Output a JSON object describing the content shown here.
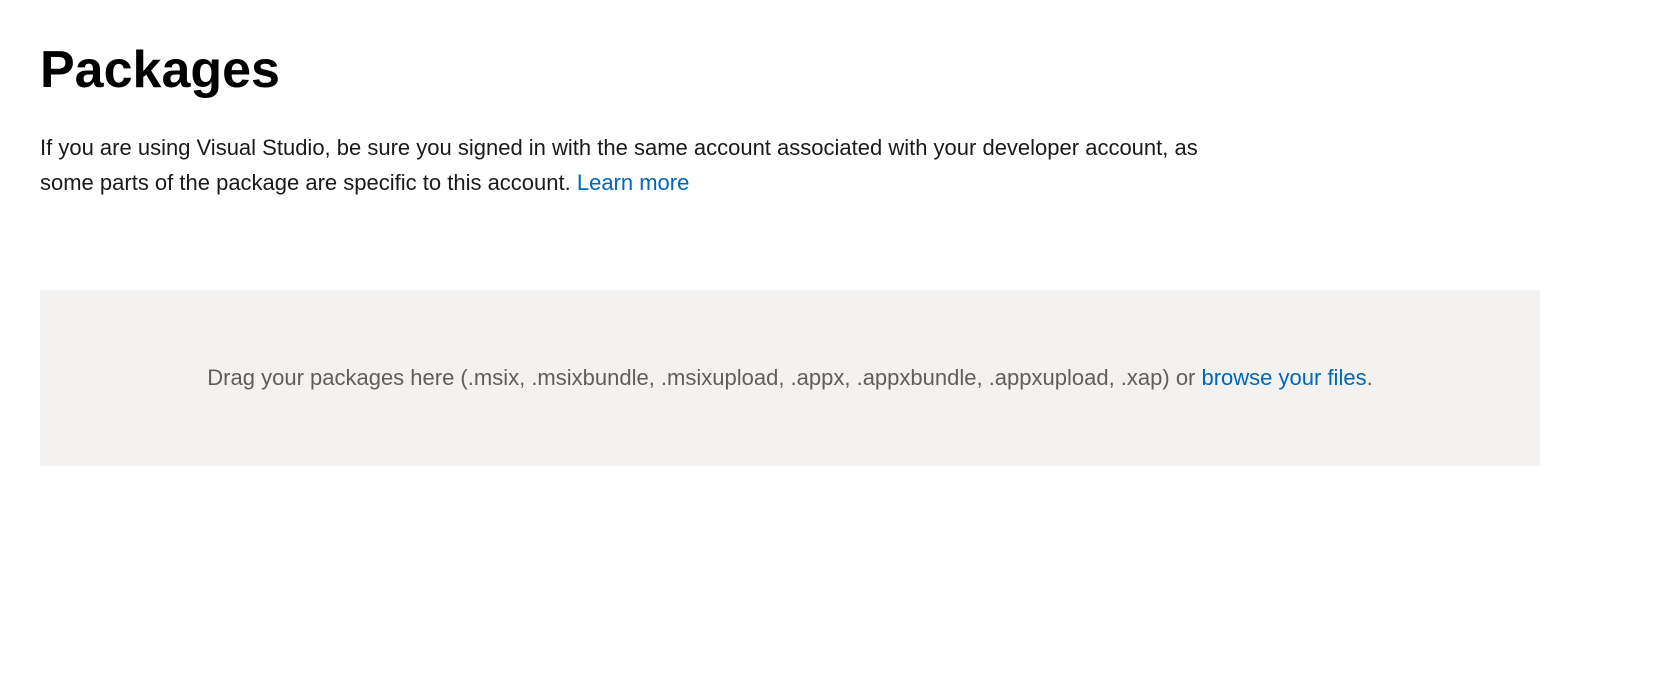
{
  "header": {
    "title": "Packages"
  },
  "description": {
    "text": "If you are using Visual Studio, be sure you signed in with the same account associated with your developer account, as some parts of the package are specific to this account. ",
    "learnMoreLabel": "Learn more"
  },
  "uploadZone": {
    "dragText": "Drag your packages here (.msix, .msixbundle, .msixupload, .appx, .appxbundle, .appxupload, .xap) or ",
    "browseLabel": "browse your files",
    "suffix": "."
  }
}
